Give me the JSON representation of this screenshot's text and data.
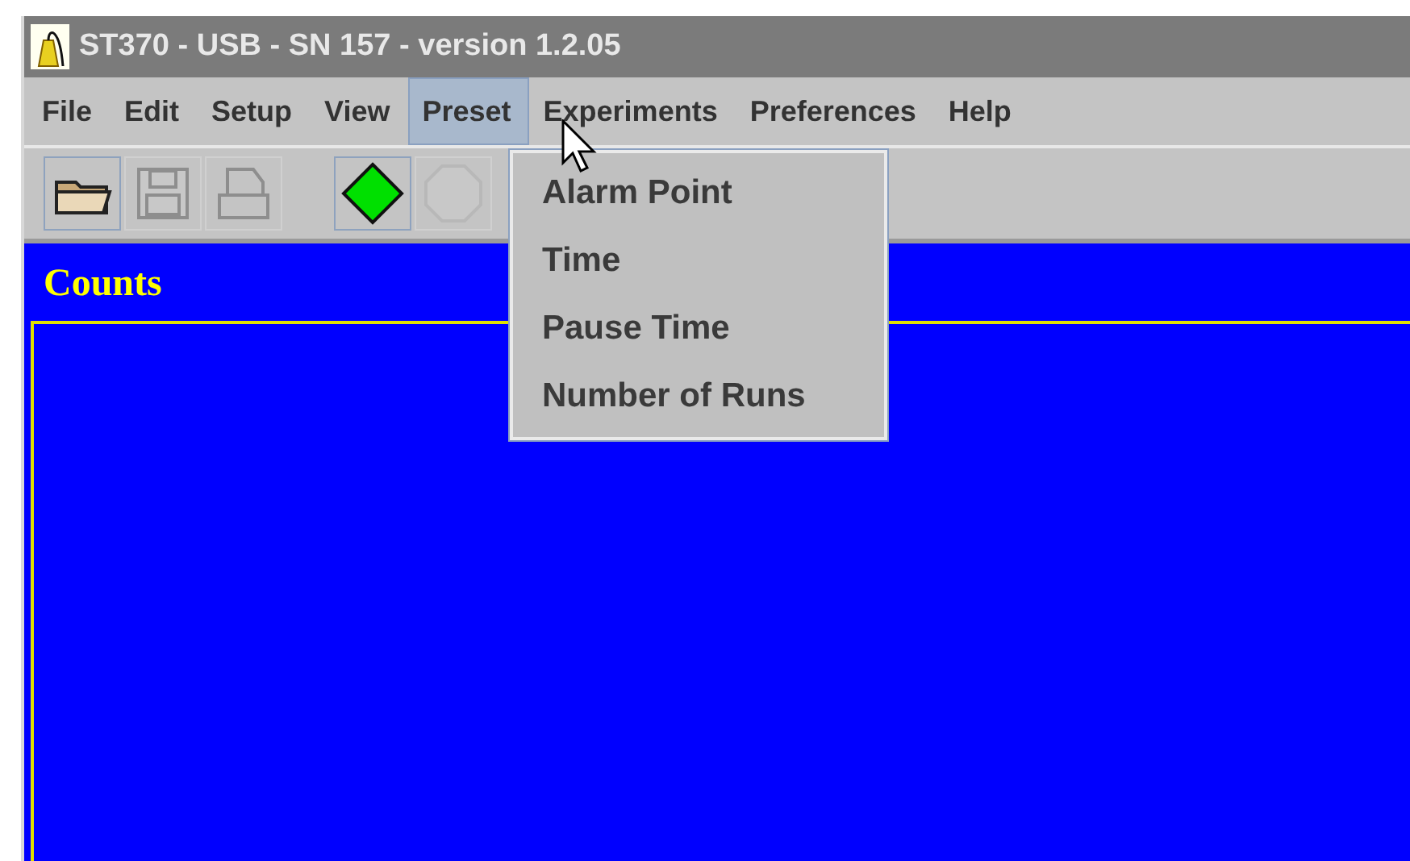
{
  "window": {
    "title": "ST370 - USB - SN 157 - version 1.2.05"
  },
  "menu_bar": [
    {
      "label": "File",
      "selected": false
    },
    {
      "label": "Edit",
      "selected": false
    },
    {
      "label": "Setup",
      "selected": false
    },
    {
      "label": "View",
      "selected": false
    },
    {
      "label": "Preset",
      "selected": true
    },
    {
      "label": "Experiments",
      "selected": false
    },
    {
      "label": "Preferences",
      "selected": false
    },
    {
      "label": "Help",
      "selected": false
    }
  ],
  "toolbar": [
    {
      "kind": "open",
      "disabled": false
    },
    {
      "kind": "save",
      "disabled": true
    },
    {
      "kind": "print",
      "disabled": true
    },
    {
      "kind": "start",
      "disabled": false
    },
    {
      "kind": "stop",
      "disabled": true
    }
  ],
  "menu_popup": {
    "items": [
      "Alarm Point",
      "Time",
      "Pause Time",
      "Number of Runs"
    ]
  },
  "plot": {
    "title": "Counts"
  }
}
